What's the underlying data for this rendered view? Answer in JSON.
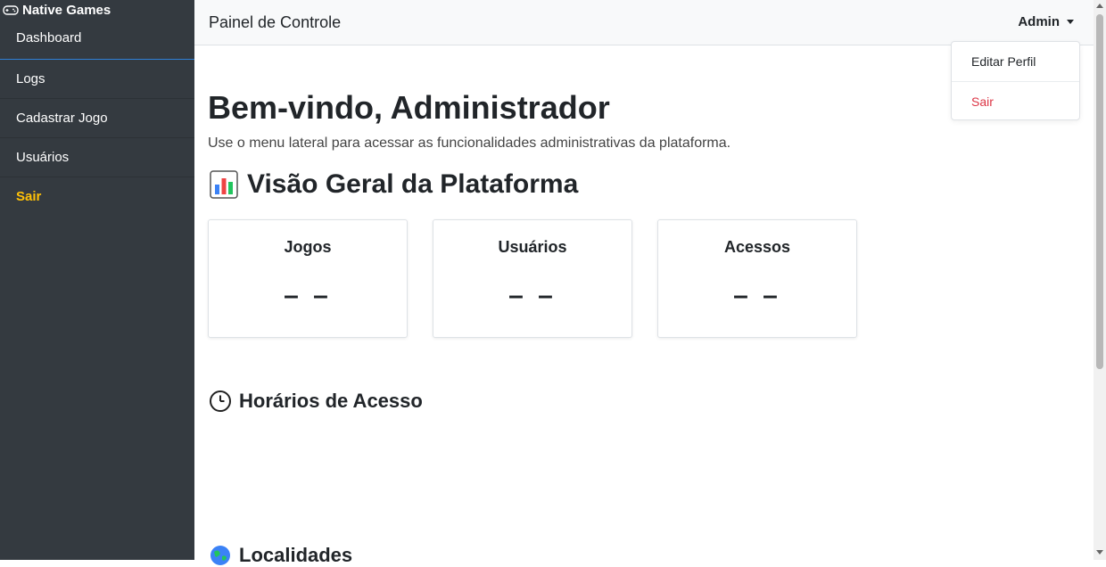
{
  "sidebar": {
    "brand": "Native Games",
    "brand_icon": "gamepad-icon",
    "items": [
      {
        "label": "Dashboard"
      },
      {
        "label": "Logs"
      },
      {
        "label": "Cadastrar Jogo"
      },
      {
        "label": "Usuários"
      },
      {
        "label": "Sair"
      }
    ]
  },
  "topbar": {
    "title": "Painel de Controle",
    "user_menu": "Admin"
  },
  "dropdown": {
    "items": [
      {
        "label": "Editar Perfil"
      },
      {
        "label": "Sair"
      }
    ]
  },
  "main": {
    "welcome": "Bem-vindo, Administrador",
    "subtitle": "Use o menu lateral para acessar as funcionalidades administrativas da plataforma.",
    "overview_title": "Visão Geral da Plataforma",
    "overview_icon": "bar-chart-icon",
    "cards": [
      {
        "title": "Jogos",
        "value": "– –"
      },
      {
        "title": "Usuários",
        "value": "– –"
      },
      {
        "title": "Acessos",
        "value": "– –"
      }
    ],
    "sections": [
      {
        "title": "Horários de Acesso",
        "icon": "clock-icon"
      },
      {
        "title": "Localidades",
        "icon": "globe-icon"
      }
    ]
  },
  "colors": {
    "sidebar_bg": "#343a40",
    "accent_exit": "#ffc107",
    "danger": "#dc3545",
    "active_border": "#2f7fd6"
  }
}
